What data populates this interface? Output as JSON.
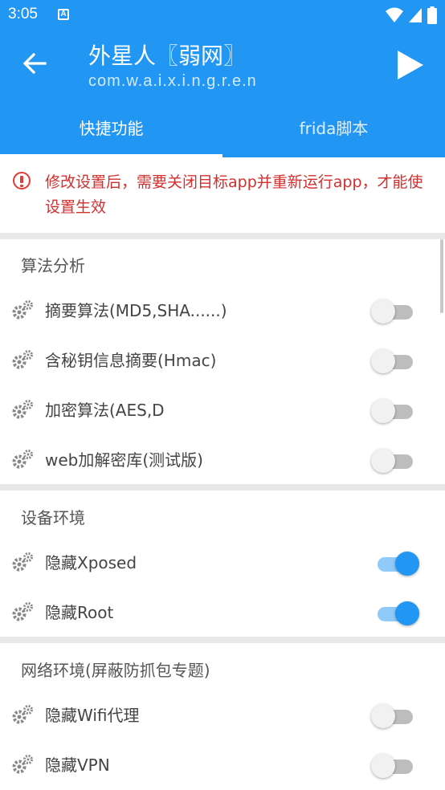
{
  "status_bar": {
    "time": "3:05",
    "notif_letter": "A"
  },
  "app": {
    "title": "外星人〖弱网〗",
    "package": "com.w.a.i.x.i.n.g.r.e.n"
  },
  "tabs": [
    {
      "label": "快捷功能",
      "selected": true
    },
    {
      "label": "frida脚本",
      "selected": false
    }
  ],
  "warning": {
    "text": "修改设置后，需要关闭目标app并重新运行app，才能使设置生效"
  },
  "sections": [
    {
      "title": "算法分析",
      "items": [
        {
          "label": "摘要算法(MD5,SHA......)",
          "enabled": false
        },
        {
          "label": "含秘钥信息摘要(Hmac)",
          "enabled": false
        },
        {
          "label": "加密算法(AES,D",
          "enabled": false
        },
        {
          "label": "web加解密库(测试版)",
          "enabled": false
        }
      ]
    },
    {
      "title": "设备环境",
      "items": [
        {
          "label": "隐藏Xposed",
          "enabled": true
        },
        {
          "label": "隐藏Root",
          "enabled": true
        }
      ]
    },
    {
      "title": "网络环境(屏蔽防抓包专题)",
      "items": [
        {
          "label": "隐藏Wifi代理",
          "enabled": false
        },
        {
          "label": "隐藏VPN",
          "enabled": false
        }
      ]
    }
  ],
  "colors": {
    "primary": "#2196F3",
    "warning": "#d32f2f",
    "switch_on": "#2196F3"
  }
}
